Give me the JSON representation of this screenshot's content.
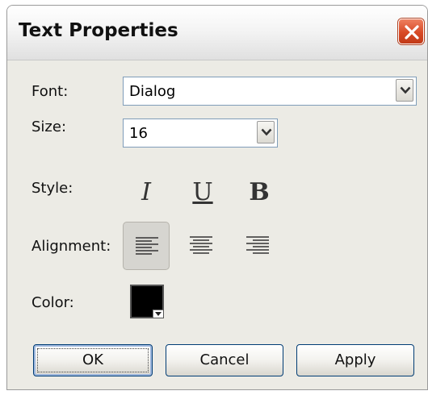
{
  "window": {
    "title": "Text Properties"
  },
  "icons": {
    "close": "close-x-icon",
    "dropdown": "chevron-down-icon"
  },
  "font": {
    "label": "Font:",
    "value": "Dialog"
  },
  "size": {
    "label": "Size:",
    "value": "16"
  },
  "style": {
    "label": "Style:",
    "italic": "I",
    "underline": "U",
    "bold": "B"
  },
  "alignment": {
    "label": "Alignment:",
    "options": [
      "left",
      "center",
      "right"
    ],
    "selected": "left"
  },
  "color": {
    "label": "Color:",
    "value": "#000000"
  },
  "buttons": {
    "ok": "OK",
    "cancel": "Cancel",
    "apply": "Apply"
  },
  "colors": {
    "accent_border": "#003c74",
    "close": "#d84a26"
  }
}
